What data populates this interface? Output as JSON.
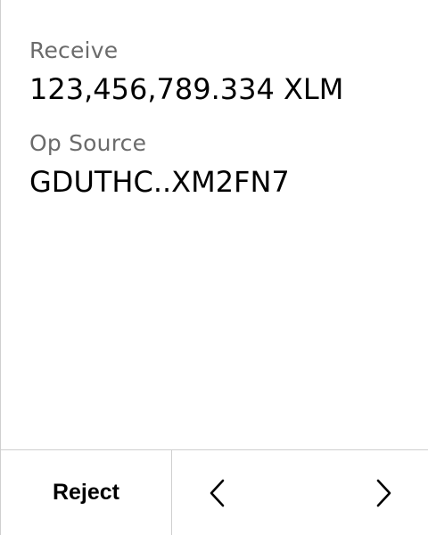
{
  "fields": [
    {
      "label": "Receive",
      "value": "123,456,789.334 XLM"
    },
    {
      "label": "Op Source",
      "value": "GDUTHC..XM2FN7"
    }
  ],
  "footer": {
    "reject_label": "Reject",
    "prev_icon": "chevron-left-icon",
    "next_icon": "chevron-right-icon"
  },
  "colors": {
    "label": "#6b6b6b",
    "value": "#000000",
    "divider": "#cfcfcf",
    "background": "#ffffff"
  }
}
